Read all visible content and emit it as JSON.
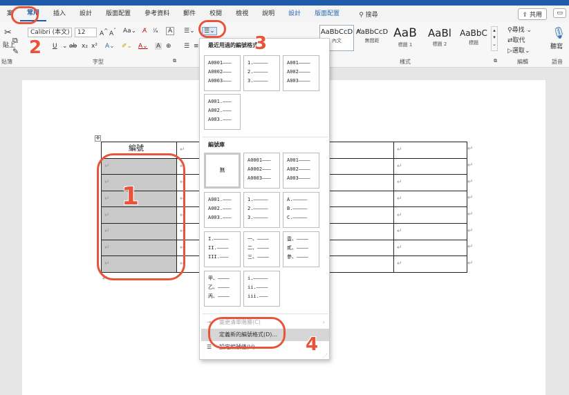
{
  "tabs": [
    "案",
    "常用",
    "插入",
    "設計",
    "版面配置",
    "參考資料",
    "郵件",
    "校閱",
    "檢視",
    "說明",
    "設計",
    "版面配置"
  ],
  "search_label": "搜尋",
  "share_label": "共用",
  "comment_label": "",
  "ribbon": {
    "font_name": "Calibri (本文)",
    "font_size": "12",
    "clipboard_label": "貼簿",
    "paste_label": "貼上",
    "font_group_label": "字型",
    "styles_group_label": "樣式",
    "editing_group_label": "編輯",
    "voice_group_label": "語音",
    "find_label": "尋找",
    "replace_label": "取代",
    "select_label": "選取",
    "dictate_label": "聽寫",
    "styles": [
      {
        "sample": "AaBbCcD",
        "name": "內文"
      },
      {
        "sample": "AaBbCcD",
        "name": "無間距"
      },
      {
        "sample": "AaB",
        "name": "標題 1"
      },
      {
        "sample": "AaBl",
        "name": "標題 2"
      },
      {
        "sample": "AaBbC",
        "name": "標題"
      }
    ]
  },
  "menu": {
    "recent_title": "最近用過的編號格式",
    "library_title": "編號庫",
    "none_label": "無",
    "recent_boxes": [
      "A0001———\nA0002———\nA0003———",
      "1.—————\n2.—————\n3.—————",
      "A001————\nA002————\nA003————",
      "A001.———\nA002.———\nA003.———"
    ],
    "library_boxes": [
      "A0001———\nA0002———\nA0003———",
      "A001————\nA002————\nA003————",
      "A001.———\nA002.———\nA003.———",
      "1.—————\n2.—————\n3.—————",
      "A.—————\nB.—————\nC.—————",
      "I.—————\nII.————\nIII.———",
      "一、————\n二、————\n三、————",
      "壹、————\n貳、————\n參、————",
      "甲、————\n乙、————\n丙、————",
      "i.—————\nii.————\niii.———"
    ],
    "change_level_label": "變更清單階層(C)",
    "define_format_label": "定義新的編號格式(D)...",
    "set_value_label": "設定編號值(V)..."
  },
  "table": {
    "header_text": "編號"
  },
  "cell_mark": "↵",
  "callouts": [
    "1",
    "2",
    "3",
    "4"
  ],
  "colors": {
    "accent": "#1e5aa8",
    "callout": "#e8543a",
    "shaded_cell": "#c9c9c9"
  }
}
